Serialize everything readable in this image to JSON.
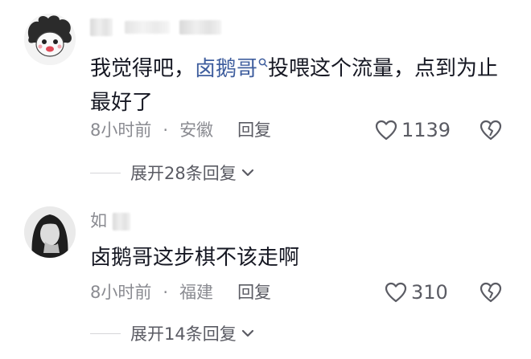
{
  "comments": [
    {
      "username_prefix": "",
      "body_before": "我觉得吧，",
      "mention": "卤鹅哥",
      "body_after": "投喂这个流量，点到为止最好了",
      "time": "8小时前",
      "location": "安徽",
      "reply_label": "回复",
      "likes": "1139",
      "expand_label": "展开28条回复"
    },
    {
      "username_prefix": "如",
      "body_before": "卤鹅哥这步棋不该走啊",
      "mention": "",
      "body_after": "",
      "time": "8小时前",
      "location": "福建",
      "reply_label": "回复",
      "likes": "310",
      "expand_label": "展开14条回复"
    }
  ],
  "separator": "·",
  "icons": {
    "mention": "search-icon",
    "like": "heart-outline-icon",
    "dislike": "broken-heart-icon",
    "expand": "chevron-down-icon"
  },
  "colors": {
    "text": "#161823",
    "secondary": "#8a8b91",
    "mention": "#3f5e9e",
    "icon": "#5a5b63"
  }
}
